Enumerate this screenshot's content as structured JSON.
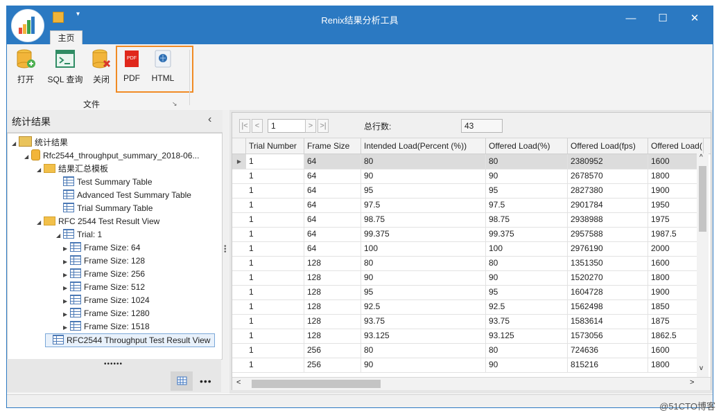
{
  "window": {
    "title": "Renix结果分析工具",
    "tab_home": "主页",
    "qat_dropdown": "▾",
    "min": "—",
    "max": "☐",
    "close": "✕"
  },
  "ribbon": {
    "open": "打开",
    "sql": "SQL 查询",
    "close": "关闭",
    "pdf": "PDF",
    "html": "HTML",
    "group_label": "文件",
    "pdf_icon_text": "PDF",
    "launcher": "↘"
  },
  "left_panel": {
    "title": "统计结果",
    "collapse": "‹",
    "grip": "••••••",
    "more": "•••",
    "tree": [
      {
        "label": "统计结果",
        "level": 0,
        "expander": "◢",
        "icon": "image-folder-icon"
      },
      {
        "label": "Rfc2544_throughput_summary_2018-06...",
        "level": 1,
        "expander": "◢",
        "icon": "database-icon"
      },
      {
        "label": "结果汇总模板",
        "level": 2,
        "expander": "◢",
        "icon": "folder-icon"
      },
      {
        "label": "Test Summary Table",
        "level": 3,
        "expander": "",
        "icon": "table-icon"
      },
      {
        "label": "Advanced Test Summary Table",
        "level": 3,
        "expander": "",
        "icon": "table-icon"
      },
      {
        "label": "Trial Summary Table",
        "level": 3,
        "expander": "",
        "icon": "table-icon"
      },
      {
        "label": "RFC 2544 Test Result View",
        "level": 2,
        "expander": "◢",
        "icon": "folder-icon"
      },
      {
        "label": "Trial: 1",
        "level": 3,
        "expander": "◢",
        "icon": "table-icon"
      },
      {
        "label": "Frame Size: 64",
        "level": 4,
        "expander": "▶",
        "icon": "table-icon"
      },
      {
        "label": "Frame Size: 128",
        "level": 4,
        "expander": "▶",
        "icon": "table-icon"
      },
      {
        "label": "Frame Size: 256",
        "level": 4,
        "expander": "▶",
        "icon": "table-icon"
      },
      {
        "label": "Frame Size: 512",
        "level": 4,
        "expander": "▶",
        "icon": "table-icon"
      },
      {
        "label": "Frame Size: 1024",
        "level": 4,
        "expander": "▶",
        "icon": "table-icon"
      },
      {
        "label": "Frame Size: 1280",
        "level": 4,
        "expander": "▶",
        "icon": "table-icon"
      },
      {
        "label": "Frame Size: 1518",
        "level": 4,
        "expander": "▶",
        "icon": "table-icon"
      },
      {
        "label": "RFC2544 Throughput Test Result View",
        "level": 2,
        "expander": "",
        "icon": "table-icon",
        "selected": true
      }
    ]
  },
  "pager": {
    "first": "|<",
    "prev": "<",
    "page": "1",
    "next": ">",
    "last": ">|",
    "total_label": "总行数:",
    "total": "43"
  },
  "table": {
    "columns": [
      "Trial Number",
      "Frame Size",
      "Intended Load(Percent (%))",
      "Offered Load(%)",
      "Offered Load(fps)",
      "Offered Load("
    ],
    "rows": [
      [
        "1",
        "64",
        "80",
        "80",
        "2380952",
        "1600"
      ],
      [
        "1",
        "64",
        "90",
        "90",
        "2678570",
        "1800"
      ],
      [
        "1",
        "64",
        "95",
        "95",
        "2827380",
        "1900"
      ],
      [
        "1",
        "64",
        "97.5",
        "97.5",
        "2901784",
        "1950"
      ],
      [
        "1",
        "64",
        "98.75",
        "98.75",
        "2938988",
        "1975"
      ],
      [
        "1",
        "64",
        "99.375",
        "99.375",
        "2957588",
        "1987.5"
      ],
      [
        "1",
        "64",
        "100",
        "100",
        "2976190",
        "2000"
      ],
      [
        "1",
        "128",
        "80",
        "80",
        "1351350",
        "1600"
      ],
      [
        "1",
        "128",
        "90",
        "90",
        "1520270",
        "1800"
      ],
      [
        "1",
        "128",
        "95",
        "95",
        "1604728",
        "1900"
      ],
      [
        "1",
        "128",
        "92.5",
        "92.5",
        "1562498",
        "1850"
      ],
      [
        "1",
        "128",
        "93.75",
        "93.75",
        "1583614",
        "1875"
      ],
      [
        "1",
        "128",
        "93.125",
        "93.125",
        "1573056",
        "1862.5"
      ],
      [
        "1",
        "256",
        "80",
        "80",
        "724636",
        "1600"
      ],
      [
        "1",
        "256",
        "90",
        "90",
        "815216",
        "1800"
      ]
    ],
    "row_indicator": "▶",
    "scroll_up": "^",
    "scroll_down": "v",
    "scroll_left": "<",
    "scroll_right": ">"
  },
  "watermark": "@51CTO博客",
  "colors": {
    "titlebar": "#2b79c2",
    "highlight": "#f08a24"
  }
}
